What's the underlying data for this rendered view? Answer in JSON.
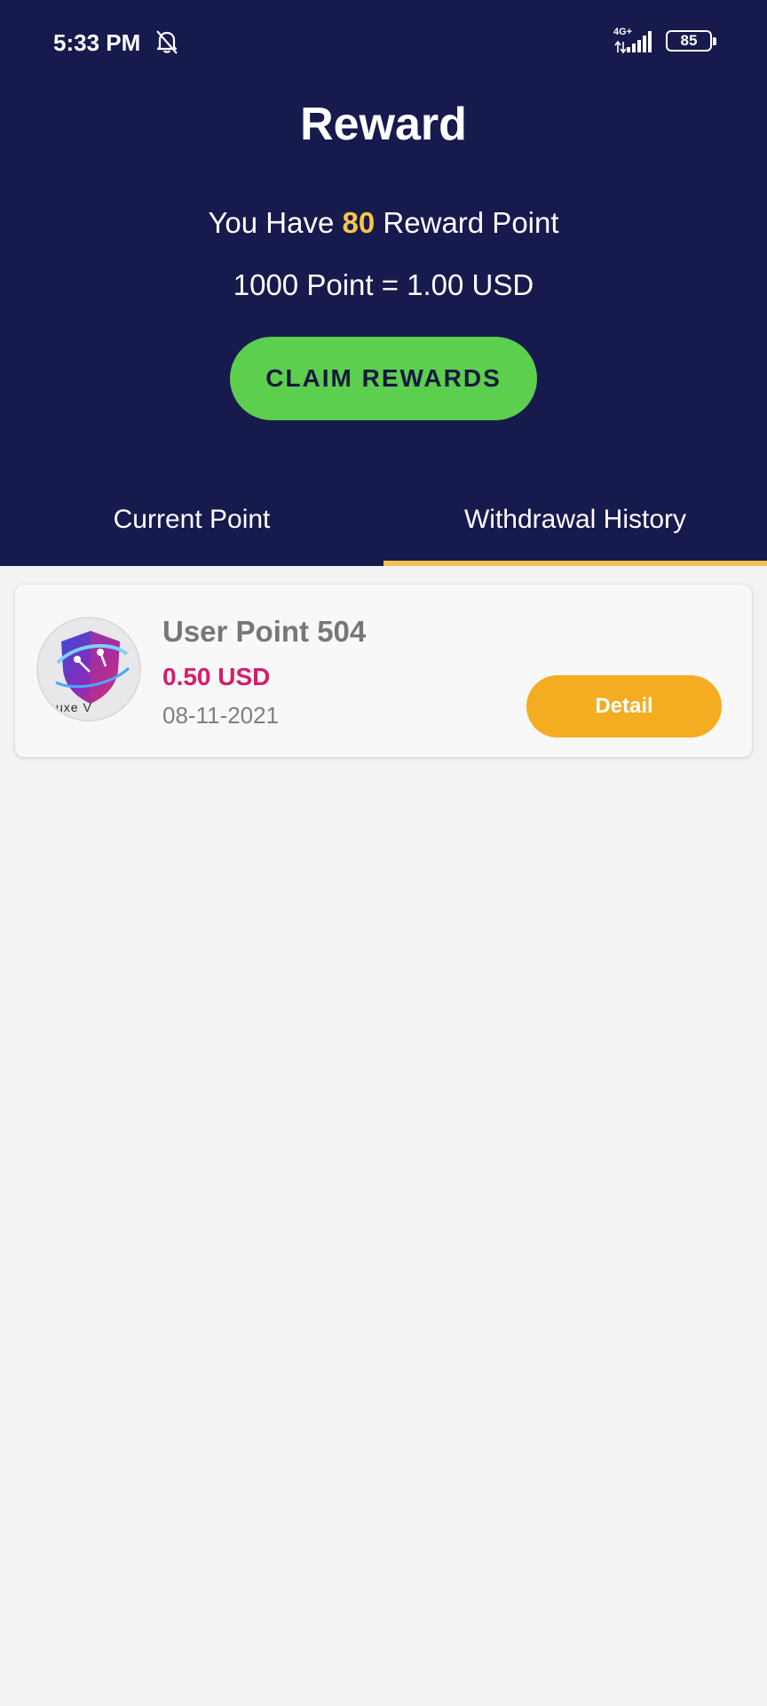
{
  "status_bar": {
    "time": "5:33 PM",
    "network": "4G+",
    "battery": "85"
  },
  "header": {
    "title": "Reward",
    "points_prefix": "You Have",
    "points_value": "80",
    "points_suffix": "Reward Point",
    "rate": "1000 Point = 1.00 USD",
    "claim_label": "CLAIM REWARDS"
  },
  "tabs": [
    {
      "label": "Current Point",
      "active": false
    },
    {
      "label": "Withdrawal History",
      "active": true
    }
  ],
  "history": [
    {
      "title": "User Point 504",
      "amount": "0.50 USD",
      "date": "08-11-2021",
      "detail_label": "Detail",
      "avatar_text": "uxe V"
    }
  ],
  "colors": {
    "header_bg": "#171a4d",
    "accent_yellow": "#f7c64a",
    "claim_green": "#5ccf4e",
    "amount_pink": "#d71d6a",
    "detail_orange": "#f4ac20"
  }
}
